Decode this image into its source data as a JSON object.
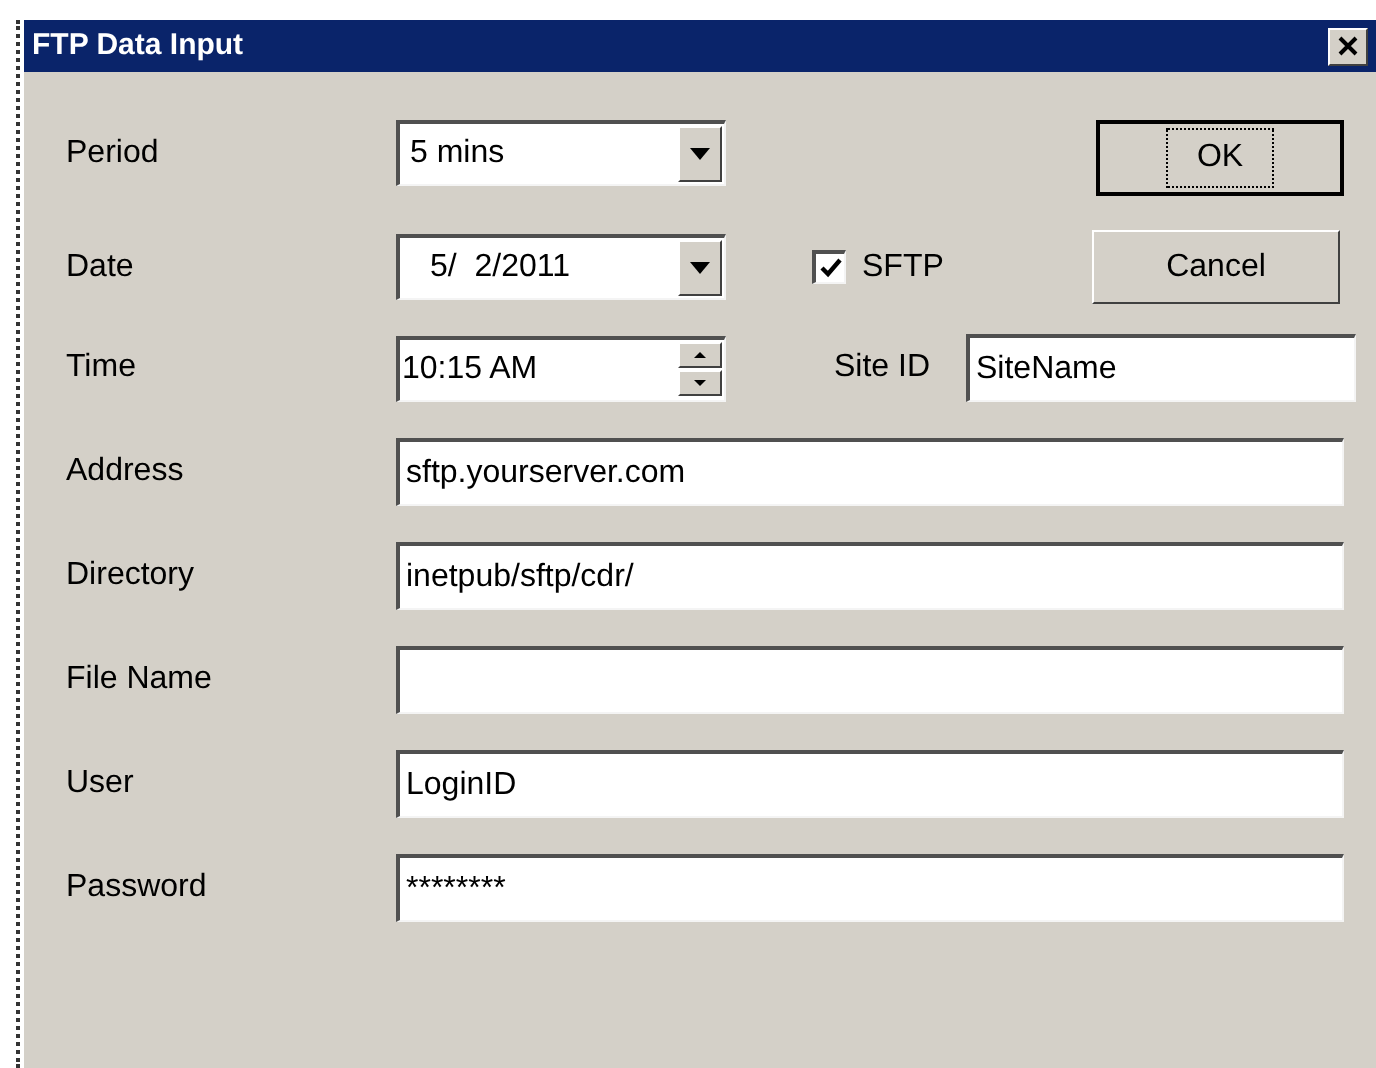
{
  "window": {
    "title": "FTP Data Input"
  },
  "period": {
    "label": "Period",
    "value": "5 mins"
  },
  "date": {
    "label": "Date",
    "value": "5/  2/2011"
  },
  "time": {
    "label": "Time",
    "value": "10:15 AM"
  },
  "sftp": {
    "label": "SFTP",
    "checked": true
  },
  "site_id": {
    "label": "Site ID",
    "value": "SiteName"
  },
  "buttons": [
    {
      "label": "OK",
      "focused": true
    },
    {
      "label": "Cancel",
      "focused": false
    }
  ],
  "fields": [
    {
      "label": "Address",
      "value": "sftp.yourserver.com"
    },
    {
      "label": "Directory",
      "value": "inetpub/sftp/cdr/"
    },
    {
      "label": "File Name"
    },
    {
      "label": "User",
      "value": "LoginID"
    },
    {
      "label": "Password",
      "value": "********"
    }
  ]
}
